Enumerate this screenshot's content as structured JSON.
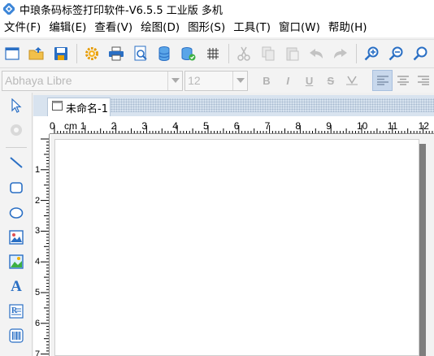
{
  "window": {
    "title": "中琅条码标签打印软件-V6.5.5 工业版 多机"
  },
  "menu": {
    "items": [
      {
        "label": "文件(F)"
      },
      {
        "label": "编辑(E)"
      },
      {
        "label": "查看(V)"
      },
      {
        "label": "绘图(D)"
      },
      {
        "label": "图形(S)"
      },
      {
        "label": "工具(T)"
      },
      {
        "label": "窗口(W)"
      },
      {
        "label": "帮助(H)"
      }
    ]
  },
  "toolbar": {
    "icons": [
      "new-window-icon",
      "open-folder-icon",
      "save-icon",
      "settings-gear-icon",
      "print-icon",
      "print-preview-icon",
      "database-icon",
      "database-setup-icon",
      "grid-icon",
      "cut-icon",
      "copy-icon",
      "paste-icon",
      "undo-icon",
      "redo-icon",
      "zoom-in-icon",
      "zoom-out-icon",
      "zoom-fit-icon"
    ]
  },
  "fontbar": {
    "font_name": "Abhaya Libre",
    "font_size": "12",
    "bold": "B",
    "italic": "I",
    "underline": "U",
    "strikethrough": "S"
  },
  "left_tools": {
    "icons": [
      "select-arrow-icon",
      "pan-icon",
      "line-tool-icon",
      "rectangle-tool-icon",
      "ellipse-tool-icon",
      "image-tool-icon",
      "picture-tool-icon",
      "text-tool-icon",
      "rich-text-tool-icon",
      "barcode-tool-icon"
    ],
    "text_tool_glyph": "A",
    "rich_text_glyph": "R"
  },
  "document": {
    "tab_title": "未命名-1"
  },
  "ruler": {
    "unit": "cm",
    "h_labels": [
      "0",
      "1",
      "2",
      "3",
      "4",
      "5",
      "6",
      "7",
      "8",
      "9",
      "10",
      "11",
      "12"
    ],
    "v_labels": [
      "1",
      "2",
      "3",
      "4",
      "5",
      "6",
      "7"
    ]
  },
  "colors": {
    "accent_blue": "#2a6fc4",
    "tab_strip": "#d8e3ef",
    "active_align": "#c8d8ec"
  }
}
